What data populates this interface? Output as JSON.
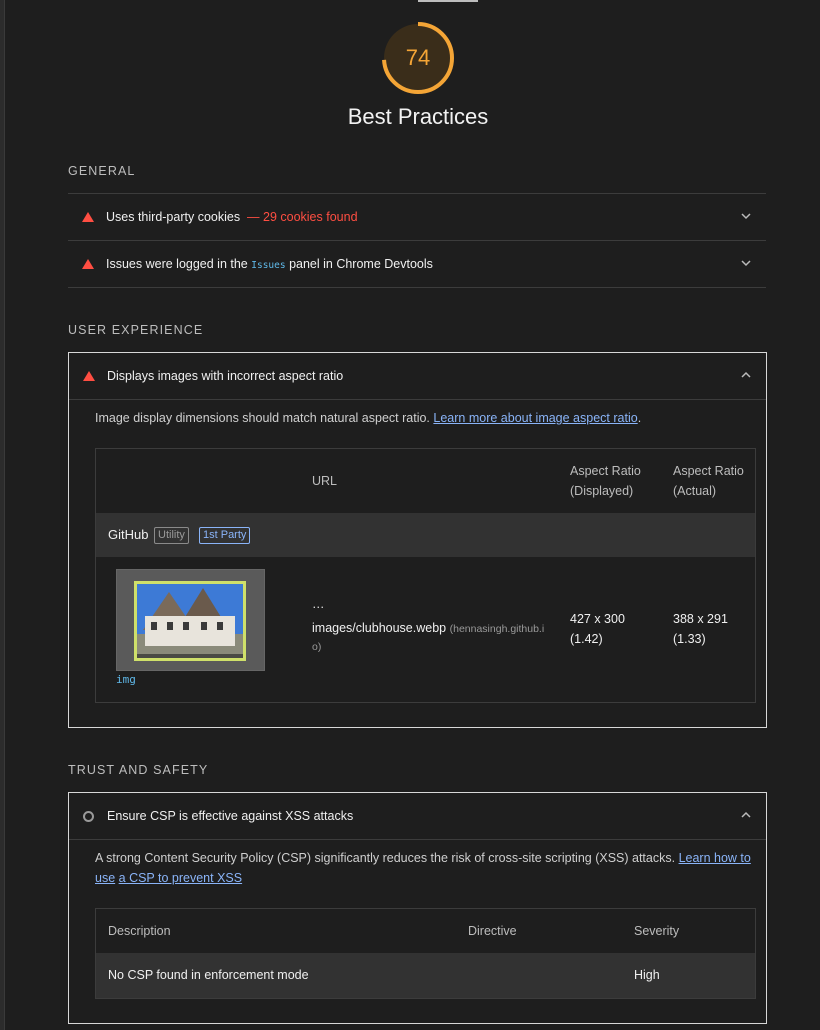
{
  "score": {
    "value": "74",
    "color": "#f4a536",
    "fraction": 0.74
  },
  "category_title": "Best Practices",
  "groups": {
    "general": "GENERAL",
    "user_experience": "USER EXPERIENCE",
    "trust_safety": "TRUST AND SAFETY"
  },
  "general_audits": [
    {
      "title": "Uses third-party cookies",
      "display_value": "— 29 cookies found",
      "status": "fail"
    },
    {
      "title_before": "Issues were logged in the",
      "code": "Issues",
      "title_after": "panel in Chrome Devtools",
      "status": "fail"
    }
  ],
  "aspect_audit": {
    "title": "Displays images with incorrect aspect ratio",
    "description": "Image display dimensions should match natural aspect ratio.",
    "link_text": "Learn more about image aspect ratio",
    "link_suffix": ".",
    "headers": {
      "url": "URL",
      "displayed": "Aspect Ratio (Displayed)",
      "actual": "Aspect Ratio (Actual)"
    },
    "entity": {
      "name": "GitHub",
      "badge_category": "Utility",
      "badge_party": "1st Party"
    },
    "row": {
      "element": "img",
      "url_prefix": "…",
      "url_path": "images/clubhouse.webp",
      "url_host_line1": "(hennasingh.github.i",
      "url_host_line2": "o)",
      "displayed_size": "427 x 300",
      "displayed_ratio": "(1.42)",
      "actual_size": "388 x 291",
      "actual_ratio": "(1.33)"
    }
  },
  "csp_audit": {
    "title": "Ensure CSP is effective against XSS attacks",
    "description": "A strong Content Security Policy (CSP) significantly reduces the risk of cross-site scripting (XSS) attacks.",
    "link_text_1": "Learn how to use",
    "link_text_2": "a CSP to prevent XSS",
    "headers": {
      "description": "Description",
      "directive": "Directive",
      "severity": "Severity"
    },
    "row": {
      "description": "No CSP found in enforcement mode",
      "directive": "",
      "severity": "High"
    }
  }
}
